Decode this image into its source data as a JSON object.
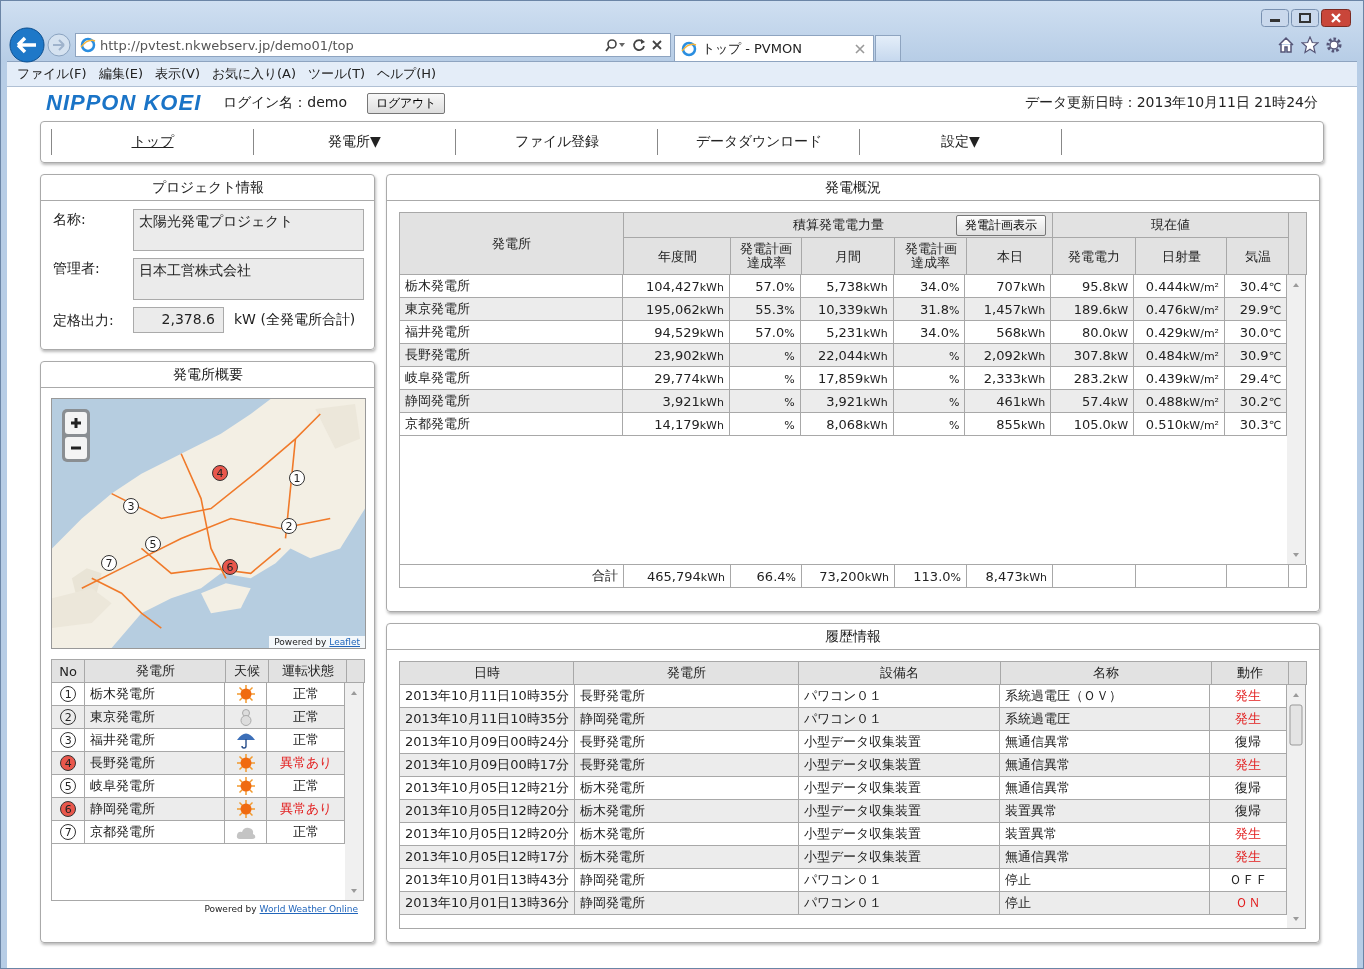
{
  "browser": {
    "url": "http://pvtest.nkwebserv.jp/demo01/top",
    "tab_title": "トップ - PVMON",
    "menu": [
      "ファイル(F)",
      "編集(E)",
      "表示(V)",
      "お気に入り(A)",
      "ツール(T)",
      "ヘルプ(H)"
    ]
  },
  "header": {
    "logo": "NIPPON KOEI",
    "login": "ログイン名：demo",
    "logout_button": "ログアウト",
    "updated": "データ更新日時：2013年10月11日 21時24分"
  },
  "nav": {
    "items": [
      {
        "label": "トップ",
        "selected": true
      },
      {
        "label": "発電所▼",
        "selected": false
      },
      {
        "label": "ファイル登録",
        "selected": false
      },
      {
        "label": "データダウンロード",
        "selected": false
      },
      {
        "label": "設定▼",
        "selected": false
      }
    ]
  },
  "project": {
    "title": "プロジェクト情報",
    "fields": [
      {
        "kind": "multiline",
        "label": "名称:",
        "value": "太陽光発電プロジェクト"
      },
      {
        "kind": "multiline",
        "label": "管理者:",
        "value": "日本工営株式会社"
      },
      {
        "kind": "number",
        "label": "定格出力:",
        "value": "2,378.6",
        "unit": "kW (全発電所合計)"
      }
    ]
  },
  "overview": {
    "title": "発電所概要",
    "map": {
      "attribution": "Powered by",
      "attribution_link": "Leaflet",
      "markers": [
        {
          "number": "4",
          "alarm": true
        },
        {
          "number": "1",
          "alarm": false
        },
        {
          "number": "3",
          "alarm": false
        },
        {
          "number": "2",
          "alarm": false
        },
        {
          "number": "5",
          "alarm": false
        },
        {
          "number": "7",
          "alarm": false
        },
        {
          "number": "6",
          "alarm": true
        }
      ]
    },
    "stations": {
      "columns": [
        "No",
        "発電所",
        "天候",
        "運転状態"
      ],
      "rows": [
        {
          "no": "1",
          "name": "栃木発電所",
          "kind": "sunny",
          "status": "正常",
          "alarm": false
        },
        {
          "no": "2",
          "name": "東京発電所",
          "kind": "snow",
          "status": "正常",
          "alarm": false
        },
        {
          "no": "3",
          "name": "福井発電所",
          "kind": "rain",
          "status": "正常",
          "alarm": false
        },
        {
          "no": "4",
          "name": "長野発電所",
          "kind": "sunny",
          "status": "異常あり",
          "alarm": true
        },
        {
          "no": "5",
          "name": "岐阜発電所",
          "kind": "sunny",
          "status": "正常",
          "alarm": false
        },
        {
          "no": "6",
          "name": "静岡発電所",
          "kind": "sunny",
          "status": "異常あり",
          "alarm": true
        },
        {
          "no": "7",
          "name": "京都発電所",
          "kind": "cloudy",
          "status": "正常",
          "alarm": false
        }
      ]
    },
    "credit": "Powered by",
    "credit_link": "World Weather Online"
  },
  "generation": {
    "title": "発電概況",
    "station_header": "発電所",
    "group_headers": [
      "積算発電電力量",
      "現在値"
    ],
    "plan_button": "発電計画表示",
    "columns": [
      "年度間",
      "発電計画達成率",
      "月間",
      "発電計画達成率",
      "本日",
      "発電電力",
      "日射量",
      "気温"
    ],
    "rows": [
      {
        "station": "栃木発電所",
        "cells": [
          {
            "value": "104,427",
            "unit": "kWh"
          },
          {
            "value": "57.0",
            "unit": "%"
          },
          {
            "value": "5,738",
            "unit": "kWh"
          },
          {
            "value": "34.0",
            "unit": "%"
          },
          {
            "value": "707",
            "unit": "kWh"
          },
          {
            "value": "95.8",
            "unit": "kW"
          },
          {
            "value": "0.444",
            "unit": "kW/m²"
          },
          {
            "value": "30.4",
            "unit": "℃"
          }
        ]
      },
      {
        "station": "東京発電所",
        "cells": [
          {
            "value": "195,062",
            "unit": "kWh"
          },
          {
            "value": "55.3",
            "unit": "%"
          },
          {
            "value": "10,339",
            "unit": "kWh"
          },
          {
            "value": "31.8",
            "unit": "%"
          },
          {
            "value": "1,457",
            "unit": "kWh"
          },
          {
            "value": "189.6",
            "unit": "kW"
          },
          {
            "value": "0.476",
            "unit": "kW/m²"
          },
          {
            "value": "29.9",
            "unit": "℃"
          }
        ]
      },
      {
        "station": "福井発電所",
        "cells": [
          {
            "value": "94,529",
            "unit": "kWh"
          },
          {
            "value": "57.0",
            "unit": "%"
          },
          {
            "value": "5,231",
            "unit": "kWh"
          },
          {
            "value": "34.0",
            "unit": "%"
          },
          {
            "value": "568",
            "unit": "kWh"
          },
          {
            "value": "80.0",
            "unit": "kW"
          },
          {
            "value": "0.429",
            "unit": "kW/m²"
          },
          {
            "value": "30.0",
            "unit": "℃"
          }
        ]
      },
      {
        "station": "長野発電所",
        "cells": [
          {
            "value": "23,902",
            "unit": "kWh"
          },
          {
            "unit": "%"
          },
          {
            "value": "22,044",
            "unit": "kWh"
          },
          {
            "unit": "%"
          },
          {
            "value": "2,092",
            "unit": "kWh"
          },
          {
            "value": "307.8",
            "unit": "kW"
          },
          {
            "value": "0.484",
            "unit": "kW/m²"
          },
          {
            "value": "30.9",
            "unit": "℃"
          }
        ]
      },
      {
        "station": "岐阜発電所",
        "cells": [
          {
            "value": "29,774",
            "unit": "kWh"
          },
          {
            "unit": "%"
          },
          {
            "value": "17,859",
            "unit": "kWh"
          },
          {
            "unit": "%"
          },
          {
            "value": "2,333",
            "unit": "kWh"
          },
          {
            "value": "283.2",
            "unit": "kW"
          },
          {
            "value": "0.439",
            "unit": "kW/m²"
          },
          {
            "value": "29.4",
            "unit": "℃"
          }
        ]
      },
      {
        "station": "静岡発電所",
        "cells": [
          {
            "value": "3,921",
            "unit": "kWh"
          },
          {
            "unit": "%"
          },
          {
            "value": "3,921",
            "unit": "kWh"
          },
          {
            "unit": "%"
          },
          {
            "value": "461",
            "unit": "kWh"
          },
          {
            "value": "57.4",
            "unit": "kW"
          },
          {
            "value": "0.488",
            "unit": "kW/m²"
          },
          {
            "value": "30.2",
            "unit": "℃"
          }
        ]
      },
      {
        "station": "京都発電所",
        "cells": [
          {
            "value": "14,179",
            "unit": "kWh"
          },
          {
            "unit": "%"
          },
          {
            "value": "8,068",
            "unit": "kWh"
          },
          {
            "unit": "%"
          },
          {
            "value": "855",
            "unit": "kWh"
          },
          {
            "value": "105.0",
            "unit": "kW"
          },
          {
            "value": "0.510",
            "unit": "kW/m²"
          },
          {
            "value": "30.3",
            "unit": "℃"
          }
        ]
      }
    ],
    "total": {
      "label": "合計",
      "cells": [
        {
          "value": "465,794",
          "unit": "kWh"
        },
        {
          "value": "66.4",
          "unit": "%"
        },
        {
          "value": "73,200",
          "unit": "kWh"
        },
        {
          "value": "113.0",
          "unit": "%"
        },
        {
          "value": "8,473",
          "unit": "kWh"
        }
      ]
    }
  },
  "history": {
    "title": "履歴情報",
    "columns": [
      "日時",
      "発電所",
      "設備名",
      "名称",
      "動作"
    ],
    "rows": [
      {
        "datetime": "2013年10月11日10時35分",
        "station": "長野発電所",
        "equipment": "パワコン０１",
        "name": "系統過電圧（ＯＶ）",
        "action": "発生",
        "alarm": true
      },
      {
        "datetime": "2013年10月11日10時35分",
        "station": "静岡発電所",
        "equipment": "パワコン０１",
        "name": "系統過電圧",
        "action": "発生",
        "alarm": true
      },
      {
        "datetime": "2013年10月09日00時24分",
        "station": "長野発電所",
        "equipment": "小型データ収集装置",
        "name": "無通信異常",
        "action": "復帰",
        "alarm": false
      },
      {
        "datetime": "2013年10月09日00時17分",
        "station": "長野発電所",
        "equipment": "小型データ収集装置",
        "name": "無通信異常",
        "action": "発生",
        "alarm": true
      },
      {
        "datetime": "2013年10月05日12時21分",
        "station": "栃木発電所",
        "equipment": "小型データ収集装置",
        "name": "無通信異常",
        "action": "復帰",
        "alarm": false
      },
      {
        "datetime": "2013年10月05日12時20分",
        "station": "栃木発電所",
        "equipment": "小型データ収集装置",
        "name": "装置異常",
        "action": "復帰",
        "alarm": false
      },
      {
        "datetime": "2013年10月05日12時20分",
        "station": "栃木発電所",
        "equipment": "小型データ収集装置",
        "name": "装置異常",
        "action": "発生",
        "alarm": true
      },
      {
        "datetime": "2013年10月05日12時17分",
        "station": "栃木発電所",
        "equipment": "小型データ収集装置",
        "name": "無通信異常",
        "action": "発生",
        "alarm": true
      },
      {
        "datetime": "2013年10月01日13時43分",
        "station": "静岡発電所",
        "equipment": "パワコン０１",
        "name": "停止",
        "action": "ＯＦＦ",
        "alarm": false
      },
      {
        "datetime": "2013年10月01日13時36分",
        "station": "静岡発電所",
        "equipment": "パワコン０１",
        "name": "停止",
        "action": "ＯＮ",
        "alarm": true
      }
    ]
  }
}
